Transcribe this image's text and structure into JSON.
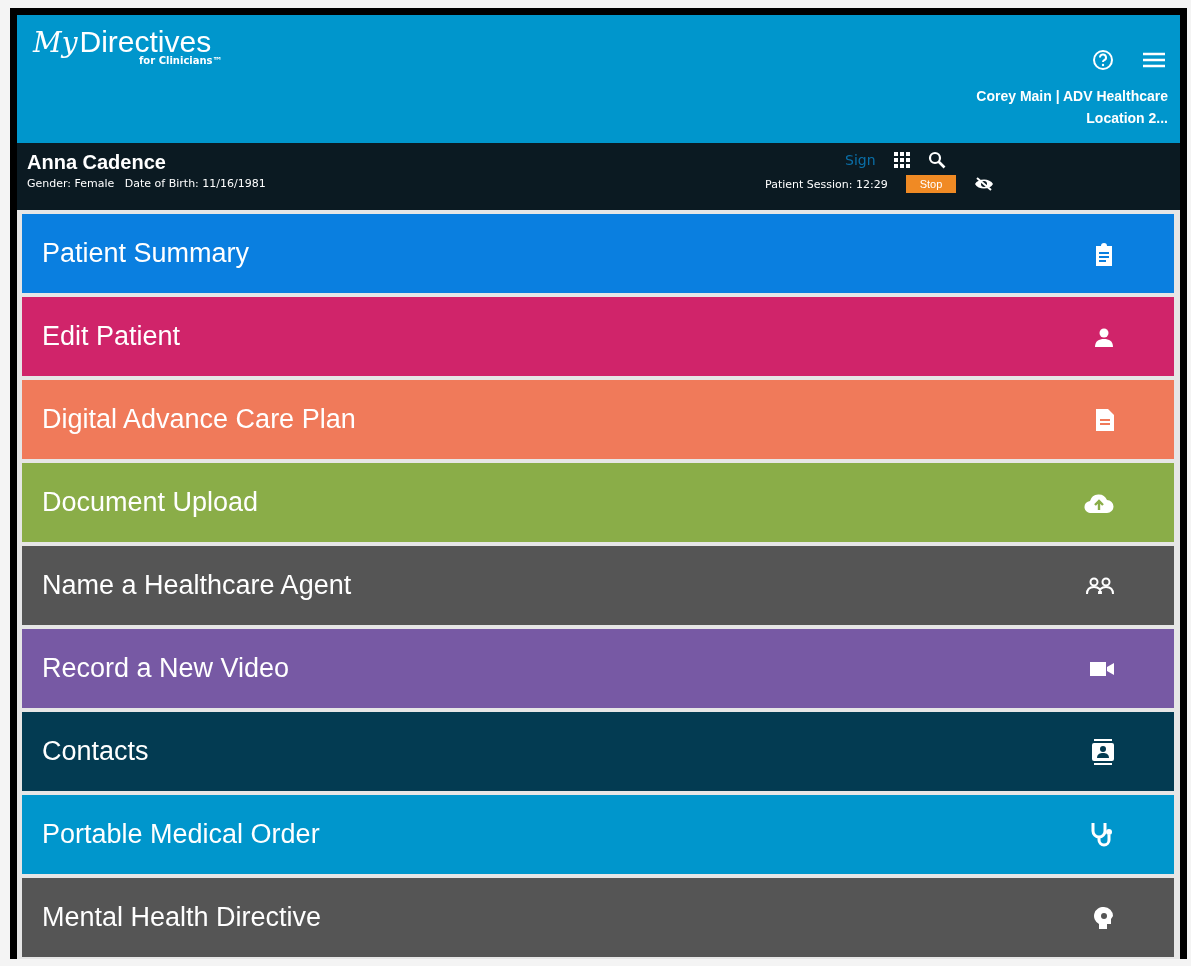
{
  "header": {
    "brand_script": "My",
    "brand": "Directives",
    "brand_sub": "for Clinicians™",
    "user": "Corey Main | ADV Healthcare",
    "location": "Location 2..."
  },
  "patient": {
    "name": "Anna Cadence",
    "details": "Gender: Female   Date of Birth: 11/16/1981",
    "sign": "Sign",
    "session": "Patient Session: 12:29",
    "stop": "Stop"
  },
  "menu": [
    {
      "label": "Patient Summary",
      "kind": "clipboard",
      "color": "#0a7fe0"
    },
    {
      "label": "Edit Patient",
      "kind": "person",
      "color": "#d0246a"
    },
    {
      "label": "Digital Advance Care Plan",
      "kind": "document",
      "color": "#f07a5a"
    },
    {
      "label": "Document Upload",
      "kind": "upload",
      "color": "#8aad48"
    },
    {
      "label": "Name a Healthcare Agent",
      "kind": "people",
      "color": "#555555"
    },
    {
      "label": "Record a New Video",
      "kind": "video",
      "color": "#7759a4"
    },
    {
      "label": "Contacts",
      "kind": "contacts",
      "color": "#033b52"
    },
    {
      "label": "Portable Medical Order",
      "kind": "stethoscope",
      "color": "#0096cc"
    },
    {
      "label": "Mental Health Directive",
      "kind": "head",
      "color": "#555555"
    }
  ]
}
